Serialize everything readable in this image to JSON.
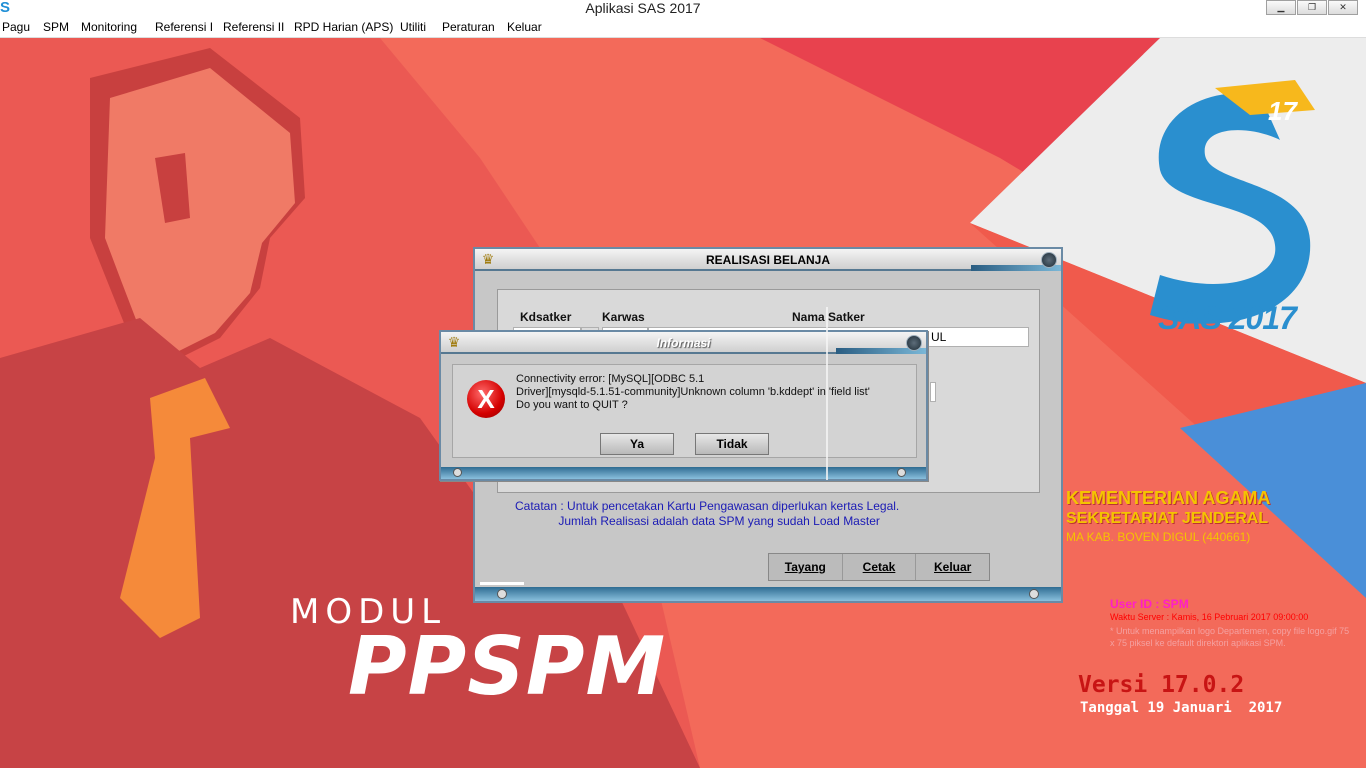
{
  "window": {
    "title": "Aplikasi SAS 2017",
    "app_icon": "S"
  },
  "menu": [
    "Pagu",
    "SPM",
    "Monitoring",
    "Referensi I",
    "Referensi II",
    "RPD Harian (APS)",
    "Utiliti",
    "Peraturan",
    "Keluar"
  ],
  "colors": {
    "background": "#f36a5a",
    "accent": "#1f8fd6",
    "brand_yellow": "#f4c400"
  },
  "brand": {
    "logo_letters": "S",
    "logo_badge": "17",
    "logo_text": "SAS 2017",
    "modul": "MODUL",
    "ppspm": "PPSPM"
  },
  "org": {
    "kementerian": "KEMENTERIAN AGAMA",
    "sekretariat": "SEKRETARIAT JENDERAL",
    "satker": "MA KAB. BOVEN DIGUL (440661)"
  },
  "info": {
    "user": "User ID : SPM",
    "waktu": "Waktu Server : Kamis, 16 Pebruari 2017 09:00:00",
    "note": "* Untuk menampilkan logo Departemen, copy file logo.gif 75 x 75 piksel ke default direktori aplikasi SPM.",
    "versi": "Versi 17.0.2",
    "tanggal": "Tanggal 19 Januari  2017"
  },
  "realisasi": {
    "title": "REALISASI BELANJA",
    "headers": {
      "kdsatker": "Kdsatker",
      "karwas": "Karwas",
      "nama_satker": "Nama Satker"
    },
    "nama_satker_value": "UL",
    "catatan_1": "Catatan : Untuk pencetakan Kartu Pengawasan diperlukan kertas Legal.",
    "catatan_2": "             Jumlah Realisasi adalah data SPM yang sudah Load Master",
    "buttons": {
      "tayang": "Tayang",
      "cetak": "Cetak",
      "keluar": "Keluar"
    }
  },
  "dialog": {
    "title": "Informasi",
    "line1": "Connectivity error: [MySQL][ODBC 5.1",
    "line2": "Driver][mysqld-5.1.51-community]Unknown column 'b.kddept' in 'field list'",
    "line3": "Do you want to QUIT ?",
    "yes": "Ya",
    "no": "Tidak",
    "icon": "X"
  }
}
